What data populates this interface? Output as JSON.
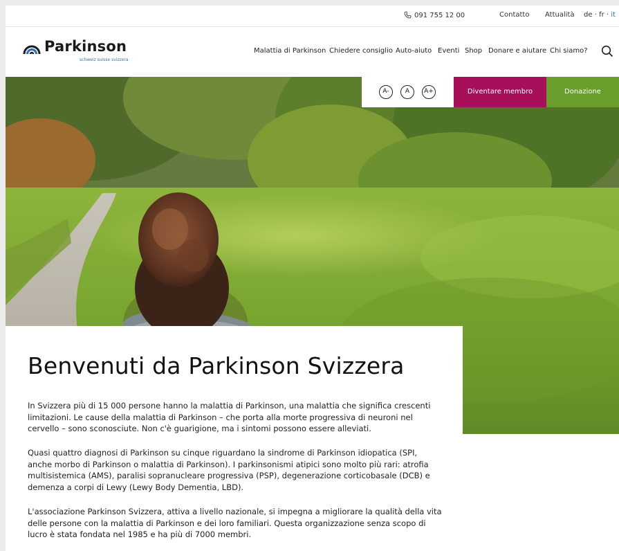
{
  "topbar": {
    "phone": "091 755 12 00",
    "contact": "Contatto",
    "news": "Attualità",
    "lang_de": "de",
    "lang_fr": "fr",
    "lang_it": "it",
    "lang_sep": "·"
  },
  "brand": {
    "name": "Parkinson",
    "tagline": "schweiz suisse svizzera",
    "color": "#2d6fb7"
  },
  "nav": {
    "items": [
      "Malattia di Parkinson",
      "Chiedere consiglio",
      "Auto-aiuto",
      "Eventi",
      "Shop",
      "Donare e aiutare",
      "Chi siamo?"
    ]
  },
  "accessibility": {
    "decrease": "A-",
    "normal": "A",
    "increase": "A+"
  },
  "cta": {
    "member": "Diventare membro",
    "member_color": "#a80f5b",
    "donate": "Donazione",
    "donate_color": "#6a9e2c"
  },
  "content": {
    "title": "Benvenuti da Parkinson Svizzera",
    "p1": "In Svizzera più di 15 000 persone hanno la malattia di Parkinson, una malattia che significa crescenti limitazioni. Le cause della malattia di Parkinson – che porta alla morte progressiva di neuroni nel cervello – sono sconosciute. Non c'è guarigione, ma i sintomi possono essere alleviati.",
    "p2": "Quasi quattro diagnosi di Parkinson su cinque riguardano la sindrome di Parkinson idiopatica (SPI, anche morbo di Parkinson o malattia di Parkinson). I parkinsonismi atipici sono molto più rari: atrofia multisistemica (AMS), paralisi sopranucleare progressiva (PSP), degenerazione corticobasale (DCB) e demenza a corpi di Lewy (Lewy Body Dementia, LBD).",
    "p3": "L'associazione Parkinson Svizzera, attiva a livello nazionale, si impegna a migliorare la qualità della vita delle persone con la malattia di Parkinson e dei loro familiari. Questa organizzazione senza scopo di lucro è stata fondata nel 1985 e ha più di 7000 membri."
  }
}
